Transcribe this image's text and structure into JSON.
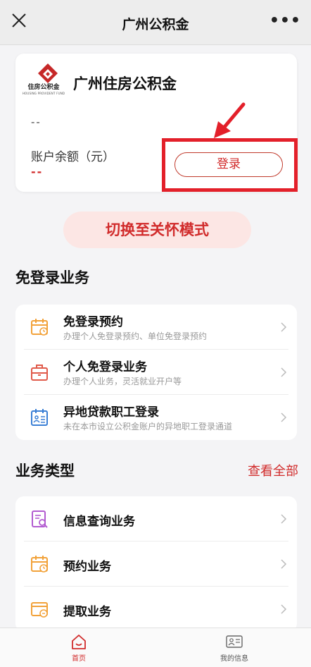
{
  "nav": {
    "title": "广州公积金",
    "more": "•••"
  },
  "account": {
    "logo_text": "住房公积金",
    "logo_sub": "HOUSING PROVIDENT FUND",
    "org_name": "广州住房公积金",
    "account_no": "--",
    "balance_label": "账户余额（元）",
    "balance_value": "--",
    "login_label": "登录"
  },
  "care_mode": "切换至关怀模式",
  "free_login": {
    "title": "免登录业务",
    "items": [
      {
        "title": "免登录预约",
        "subtitle": "办理个人免登录预约、单位免登录预约",
        "icon": "calendar-icon"
      },
      {
        "title": "个人免登录业务",
        "subtitle": "办理个人业务，灵活就业开户等",
        "icon": "briefcase-icon"
      },
      {
        "title": "异地贷款职工登录",
        "subtitle": "未在本市设立公积金账户的异地职工登录通道",
        "icon": "calendar-list-icon"
      }
    ]
  },
  "business": {
    "title": "业务类型",
    "view_all": "查看全部",
    "items": [
      {
        "title": "信息查询业务",
        "icon": "document-search-icon"
      },
      {
        "title": "预约业务",
        "icon": "calendar-icon"
      },
      {
        "title": "提取业务",
        "icon": "withdraw-card-icon"
      }
    ]
  },
  "tabs": [
    {
      "label": "首页",
      "icon": "home-icon",
      "active": true
    },
    {
      "label": "我的信息",
      "icon": "id-card-icon",
      "active": false
    }
  ],
  "colors": {
    "accent": "#d12b2b",
    "highlight": "#e3202a",
    "icon_orange": "#f2a23a",
    "icon_red": "#e05a4a",
    "icon_blue": "#3a7fd5",
    "icon_purple": "#b25bd0"
  }
}
